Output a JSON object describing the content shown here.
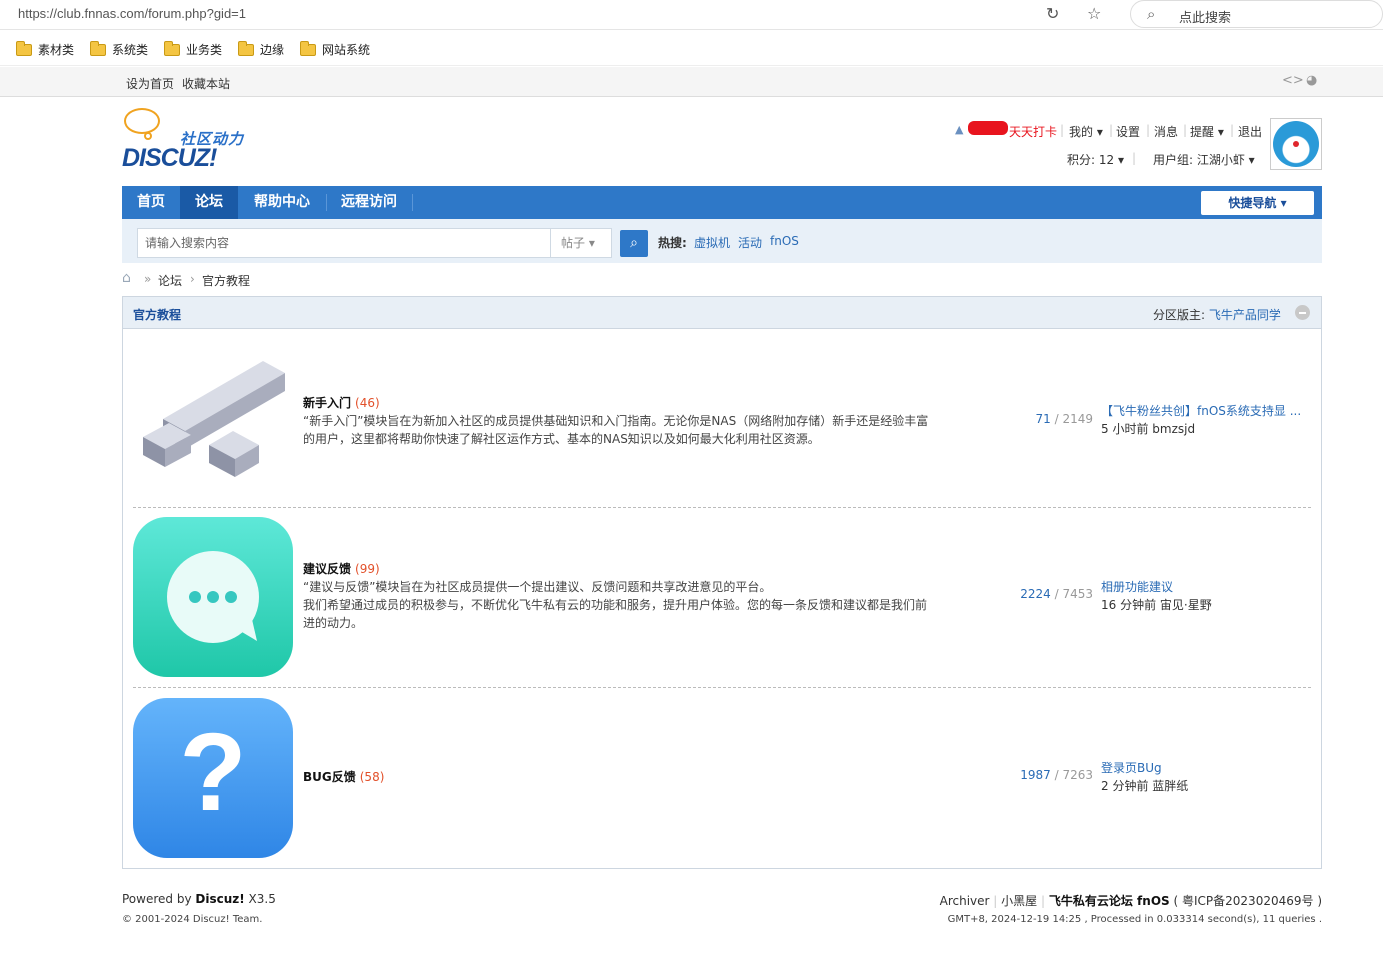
{
  "browser": {
    "url": "https://club.fnnas.com/forum.php?gid=1",
    "search_placeholder": "点此搜索",
    "bookmarks": [
      "素材类",
      "系统类",
      "业务类",
      "边缘",
      "网站系统"
    ]
  },
  "topbar": {
    "set_home": "设为首页",
    "bookmark_site": "收藏本站"
  },
  "logo": {
    "zh": "社区动力",
    "en": "DISCUZ!"
  },
  "userbar": {
    "checkin": "天天打卡",
    "mine": "我的",
    "settings": "设置",
    "messages": "消息",
    "reminders": "提醒",
    "logout": "退出",
    "points": "积分: 12",
    "usergroup": "用户组: 江湖小虾"
  },
  "nav": {
    "items": [
      "首页",
      "论坛",
      "帮助中心",
      "远程访问"
    ],
    "active": "论坛",
    "quick_nav": "快捷导航"
  },
  "search": {
    "placeholder": "请输入搜索内容",
    "type": "帖子",
    "hot_label": "热搜:",
    "hot_words": [
      "虚拟机",
      "活动",
      "fnOS"
    ]
  },
  "breadcrumb": [
    "论坛",
    "官方教程"
  ],
  "section": {
    "title": "官方教程",
    "moderator_label": "分区版主:",
    "moderator": "飞牛产品同学"
  },
  "forums": [
    {
      "name": "新手入门",
      "today": "(46)",
      "desc": [
        "“新手入门”模块旨在为新加入社区的成员提供基础知识和入门指南。无论你是NAS（网络附加存储）新手还是经验丰富的用户，这里都将帮助你快速了解社区运作方式、基本的NAS知识以及如何最大化利用社区资源。"
      ],
      "threads": "71",
      "posts": "2149",
      "last_title": "【飞牛粉丝共创】fnOS系统支持显 ...",
      "last_meta": "5 小时前 bmzsjd"
    },
    {
      "name": "建议反馈",
      "today": "(99)",
      "desc": [
        "“建议与反馈”模块旨在为社区成员提供一个提出建议、反馈问题和共享改进意见的平台。",
        "我们希望通过成员的积极参与，不断优化飞牛私有云的功能和服务，提升用户体验。您的每一条反馈和建议都是我们前进的动力。"
      ],
      "threads": "2224",
      "posts": "7453",
      "last_title": "相册功能建议",
      "last_meta": "16 分钟前 宙见·星野"
    },
    {
      "name": "BUG反馈",
      "today": "(58)",
      "desc": [],
      "threads": "1987",
      "posts": "7263",
      "last_title": "登录页BUg",
      "last_meta": "2 分钟前 蓝胖纸"
    }
  ],
  "footer": {
    "powered_prefix": "Powered by ",
    "powered_name": "Discuz!",
    "powered_ver": " X3.5",
    "copyright": "© 2001-2024 Discuz! Team.",
    "archiver": "Archiver",
    "blackroom": "小黑屋",
    "site_name": "飞牛私有云论坛 fnOS",
    "icp": "( 粤ICP备2023020469号 )",
    "processed": "GMT+8, 2024-12-19 14:25 , Processed in 0.033314 second(s), 11 queries ."
  },
  "colors": {
    "nav_blue": "#2e78c8",
    "nav_active": "#1a5aa6",
    "link_blue": "#2a6bb5",
    "today_red": "#e2502a"
  }
}
